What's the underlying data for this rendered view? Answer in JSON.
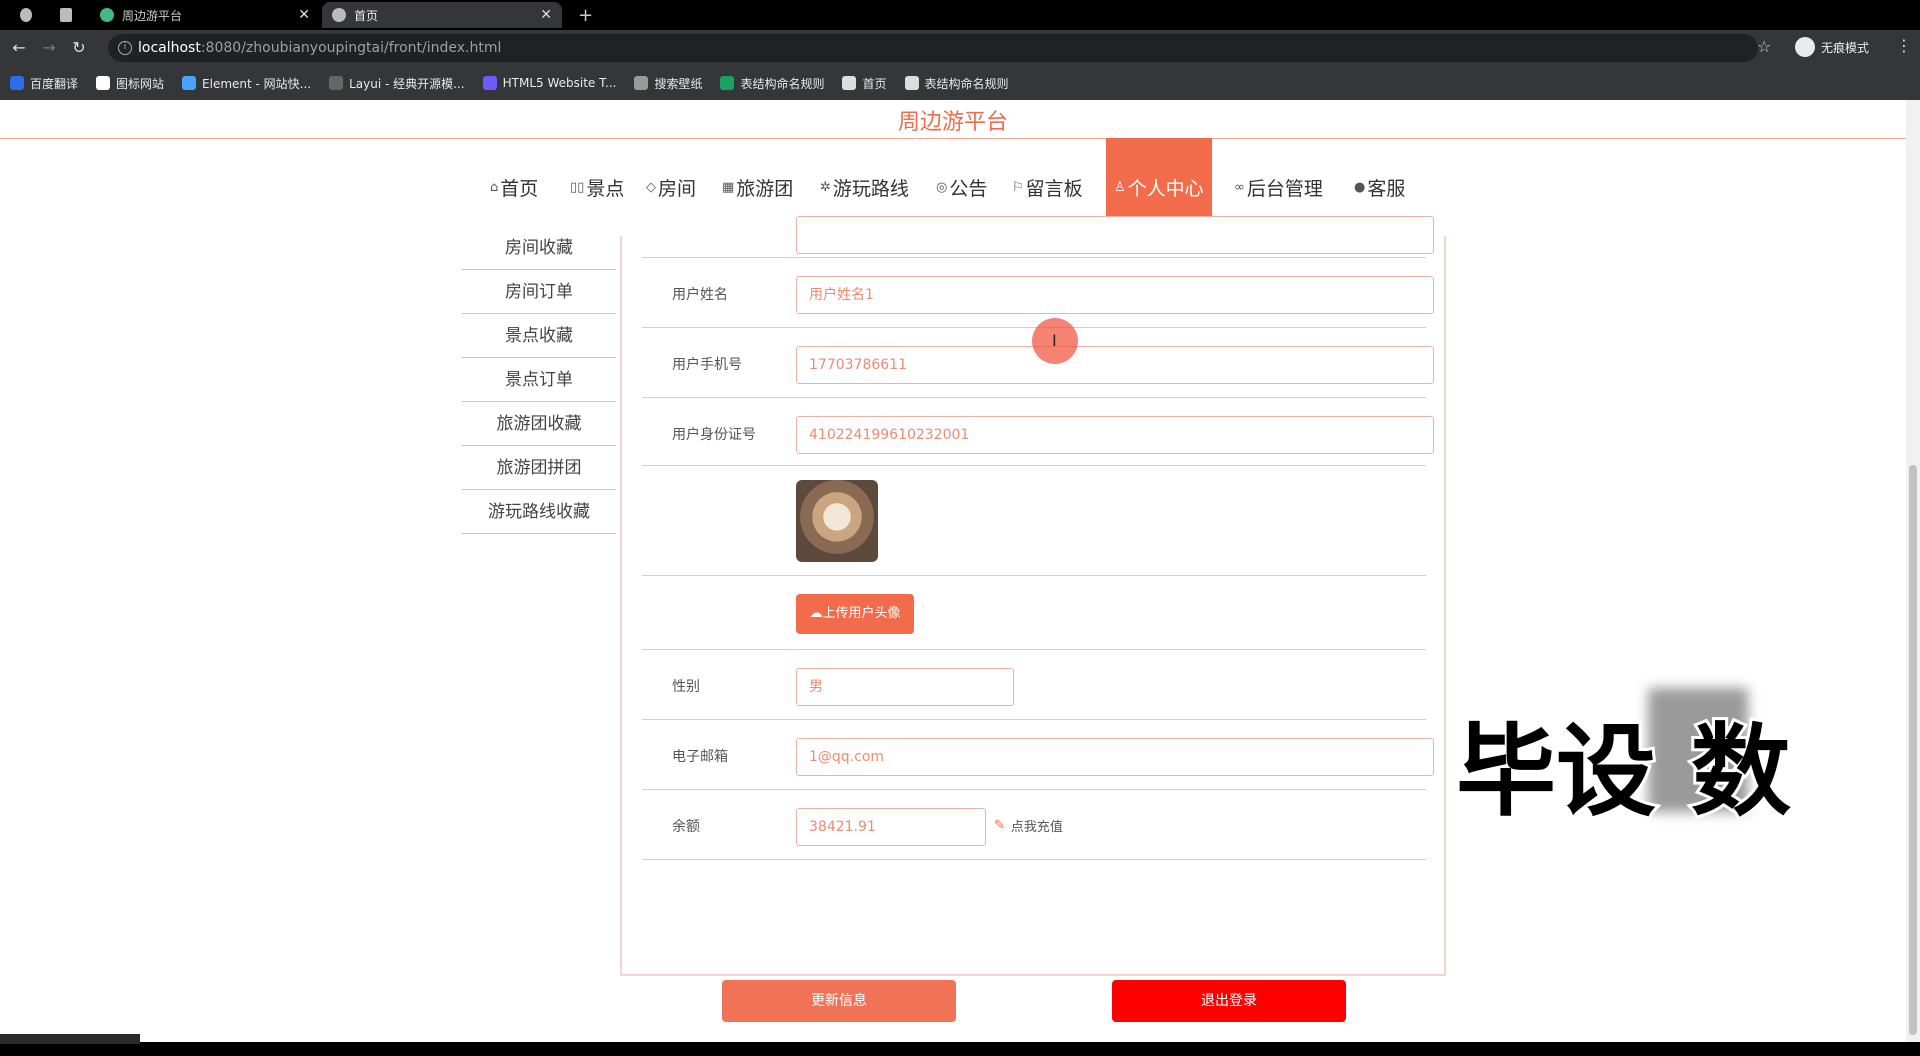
{
  "browser": {
    "tabs": [
      {
        "title": "周边游平台"
      },
      {
        "title": "首页"
      }
    ],
    "new_tab": "+",
    "url_host": "localhost",
    "url_path": ":8080/zhoubianyoupingtai/front/index.html",
    "incognito_label": "无痕模式",
    "bookmarks": [
      {
        "label": "百度翻译",
        "color": "#2b6de8"
      },
      {
        "label": "图标网站",
        "color": "#ffffff"
      },
      {
        "label": "Element - 网站快...",
        "color": "#4aa3ff"
      },
      {
        "label": "Layui - 经典开源模...",
        "color": "#666666"
      },
      {
        "label": "HTML5 Website T...",
        "color": "#6b5cff"
      },
      {
        "label": "搜索壁纸",
        "color": "#999999"
      },
      {
        "label": "表结构命名规则",
        "color": "#1aa260"
      },
      {
        "label": "首页",
        "color": "#dddddd"
      },
      {
        "label": "表结构命名规则",
        "color": "#dddddd"
      }
    ]
  },
  "site": {
    "title": "周边游平台",
    "accent": "#f26b4b",
    "nav": [
      {
        "label": "首页",
        "icon": "home-icon"
      },
      {
        "label": "景点",
        "icon": "scenic-icon"
      },
      {
        "label": "房间",
        "icon": "tag-icon"
      },
      {
        "label": "旅游团",
        "icon": "group-icon"
      },
      {
        "label": "游玩路线",
        "icon": "route-icon"
      },
      {
        "label": "公告",
        "icon": "notice-icon"
      },
      {
        "label": "留言板",
        "icon": "flag-icon"
      },
      {
        "label": "个人中心",
        "icon": "user-icon",
        "active": true
      },
      {
        "label": "后台管理",
        "icon": "link-icon"
      },
      {
        "label": "客服",
        "icon": "service-icon"
      }
    ]
  },
  "sidemenu": [
    "房间收藏",
    "房间订单",
    "景点收藏",
    "景点订单",
    "旅游团收藏",
    "旅游团拼团",
    "游玩路线收藏"
  ],
  "form": {
    "name_label": "用户姓名",
    "name_value": "用户姓名1",
    "phone_label": "用户手机号",
    "phone_value": "17703786611",
    "idcard_label": "用户身份证号",
    "idcard_value": "410224199610232001",
    "upload_label": "上传用户头像",
    "gender_label": "性别",
    "gender_value": "男",
    "email_label": "电子邮箱",
    "email_value": "1@qq.com",
    "balance_label": "余额",
    "balance_value": "38421.91",
    "recharge_label": "点我充值",
    "update_button": "更新信息",
    "logout_button": "退出登录"
  },
  "watermark": "毕设 数"
}
